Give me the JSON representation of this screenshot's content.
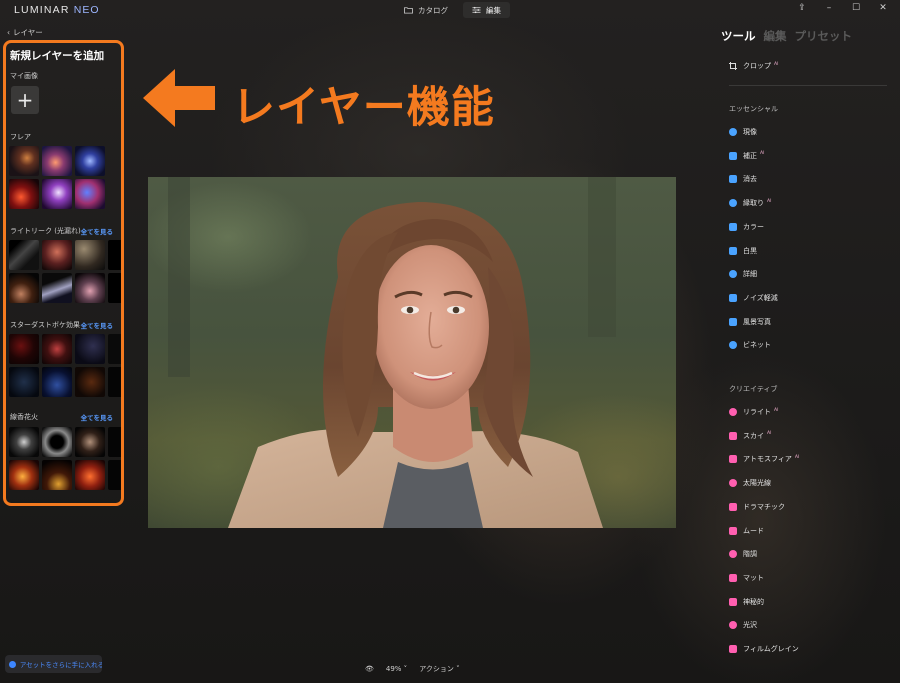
{
  "app": {
    "logo_main": "LUMINAR",
    "logo_sub": "NEO"
  },
  "top_tabs": [
    {
      "label": "カタログ",
      "icon": "folder-icon",
      "active": false
    },
    {
      "label": "編集",
      "icon": "sliders-icon",
      "active": true
    }
  ],
  "window_controls": [
    "share-icon",
    "minimize-icon",
    "maximize-icon",
    "close-icon"
  ],
  "back": {
    "label": "レイヤー"
  },
  "left_panel": {
    "title": "新規レイヤーを追加",
    "my_image_label": "マイ画像",
    "add_symbol": "+",
    "sections": [
      {
        "label": "フレア",
        "see_all": ""
      },
      {
        "label": "ライトリーク (光漏れ)",
        "see_all": "全てを見る"
      },
      {
        "label": "スターダストボケ効果",
        "see_all": "全てを見る"
      },
      {
        "label": "線香花火",
        "see_all": "全てを見る"
      }
    ]
  },
  "annotation": {
    "text": "レイヤー機能",
    "color": "#f47a1f"
  },
  "right_panel": {
    "tabs": [
      {
        "label": "ツール",
        "active": true
      },
      {
        "label": "編集",
        "active": false
      },
      {
        "label": "プリセット",
        "active": false
      }
    ],
    "crop": {
      "label": "クロップ",
      "ai": "AI"
    },
    "essentials_label": "エッセンシャル",
    "essentials": [
      {
        "label": "現像",
        "ai": "",
        "icon": "sun-icon",
        "color": "#4aa3ff"
      },
      {
        "label": "補正",
        "ai": "AI",
        "icon": "sparkle-icon",
        "color": "#4aa3ff"
      },
      {
        "label": "消去",
        "ai": "",
        "icon": "eraser-icon",
        "color": "#4aa3ff"
      },
      {
        "label": "縁取り",
        "ai": "AI",
        "icon": "structure-icon",
        "color": "#4aa3ff"
      },
      {
        "label": "カラー",
        "ai": "",
        "icon": "color-icon",
        "color": "#4aa3ff"
      },
      {
        "label": "白黒",
        "ai": "",
        "icon": "bw-icon",
        "color": "#4aa3ff"
      },
      {
        "label": "詳細",
        "ai": "",
        "icon": "detail-icon",
        "color": "#4aa3ff"
      },
      {
        "label": "ノイズ軽減",
        "ai": "",
        "icon": "noise-icon",
        "color": "#4aa3ff"
      },
      {
        "label": "風景写真",
        "ai": "",
        "icon": "landscape-icon",
        "color": "#4aa3ff"
      },
      {
        "label": "ビネット",
        "ai": "",
        "icon": "vignette-icon",
        "color": "#4aa3ff"
      }
    ],
    "creative_label": "クリエイティブ",
    "creative": [
      {
        "label": "リライト",
        "ai": "AI",
        "icon": "relight-icon",
        "color": "#ff5fb0"
      },
      {
        "label": "スカイ",
        "ai": "AI",
        "icon": "cloud-icon",
        "color": "#ff5fb0"
      },
      {
        "label": "アトモスフィア",
        "ai": "AI",
        "icon": "atmosphere-icon",
        "color": "#ff5fb0"
      },
      {
        "label": "太陽光線",
        "ai": "",
        "icon": "sunrays-icon",
        "color": "#ff5fb0"
      },
      {
        "label": "ドラマチック",
        "ai": "",
        "icon": "lightning-icon",
        "color": "#ff5fb0"
      },
      {
        "label": "ムード",
        "ai": "",
        "icon": "mood-icon",
        "color": "#ff5fb0"
      },
      {
        "label": "階調",
        "ai": "",
        "icon": "toning-icon",
        "color": "#ff5fb0"
      },
      {
        "label": "マット",
        "ai": "",
        "icon": "matte-icon",
        "color": "#ff5fb0"
      },
      {
        "label": "神秘的",
        "ai": "",
        "icon": "mystical-icon",
        "color": "#ff5fb0"
      },
      {
        "label": "光沢",
        "ai": "",
        "icon": "glow-icon",
        "color": "#ff5fb0"
      },
      {
        "label": "フィルムグレイン",
        "ai": "",
        "icon": "grain-icon",
        "color": "#ff5fb0"
      }
    ]
  },
  "bottom": {
    "promo": "アセットをさらに手に入れる",
    "zoom": "49%",
    "actions": "アクション"
  }
}
